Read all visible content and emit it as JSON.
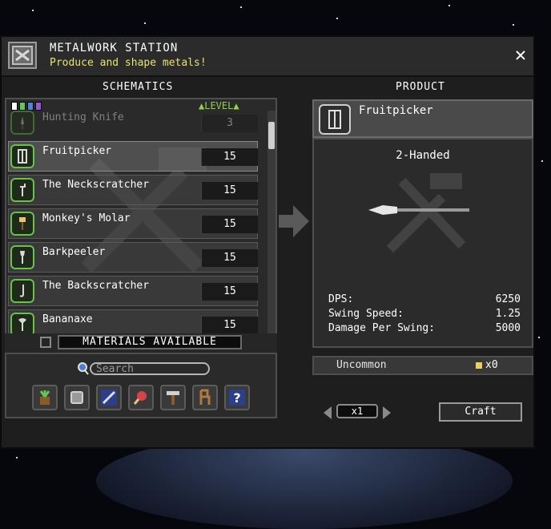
{
  "window": {
    "title": "METALWORK STATION",
    "subtitle": "Produce and shape metals!",
    "close_label": "✕"
  },
  "schematics": {
    "heading": "SCHEMATICS",
    "level_header": "▲LEVEL▲",
    "rarity_colors": [
      "#ffffff",
      "#5ecb4f",
      "#4a86d8",
      "#9a57d3"
    ],
    "recipes": [
      {
        "name": "Hunting Knife",
        "level": "3",
        "icon": "knife-icon",
        "state": "faded"
      },
      {
        "name": "Fruitpicker",
        "level": "15",
        "icon": "fruitpicker-icon",
        "state": "selected"
      },
      {
        "name": "The Neckscratcher",
        "level": "15",
        "icon": "neckscratcher-icon",
        "state": "normal"
      },
      {
        "name": "Monkey's Molar",
        "level": "15",
        "icon": "monkeys-molar-icon",
        "state": "normal"
      },
      {
        "name": "Barkpeeler",
        "level": "15",
        "icon": "barkpeeler-icon",
        "state": "normal"
      },
      {
        "name": "The Backscratcher",
        "level": "15",
        "icon": "backscratcher-icon",
        "state": "normal"
      },
      {
        "name": "Bananaxe",
        "level": "15",
        "icon": "bananaxe-icon",
        "state": "normal"
      }
    ],
    "materials_label": "MATERIALS AVAILABLE"
  },
  "search": {
    "placeholder": "Search"
  },
  "filters": [
    {
      "icon": "plant-filter-icon"
    },
    {
      "icon": "armor-filter-icon"
    },
    {
      "icon": "weapon-filter-icon"
    },
    {
      "icon": "food-filter-icon"
    },
    {
      "icon": "tools-filter-icon"
    },
    {
      "icon": "furniture-filter-icon"
    },
    {
      "icon": "misc-filter-icon"
    }
  ],
  "product": {
    "heading": "PRODUCT",
    "name": "Fruitpicker",
    "handedness": "2-Handed",
    "stats": [
      {
        "label": "DPS:",
        "value": "6250"
      },
      {
        "label": "Swing Speed:",
        "value": "1.25"
      },
      {
        "label": "Damage Per Swing:",
        "value": "5000"
      }
    ],
    "rarity": "Uncommon",
    "owned_count": "x0"
  },
  "craft": {
    "quantity": "x1",
    "button_label": "Craft"
  },
  "colors": {
    "accent_green": "#8fd14f",
    "subtitle_yellow": "#e8e36e"
  }
}
